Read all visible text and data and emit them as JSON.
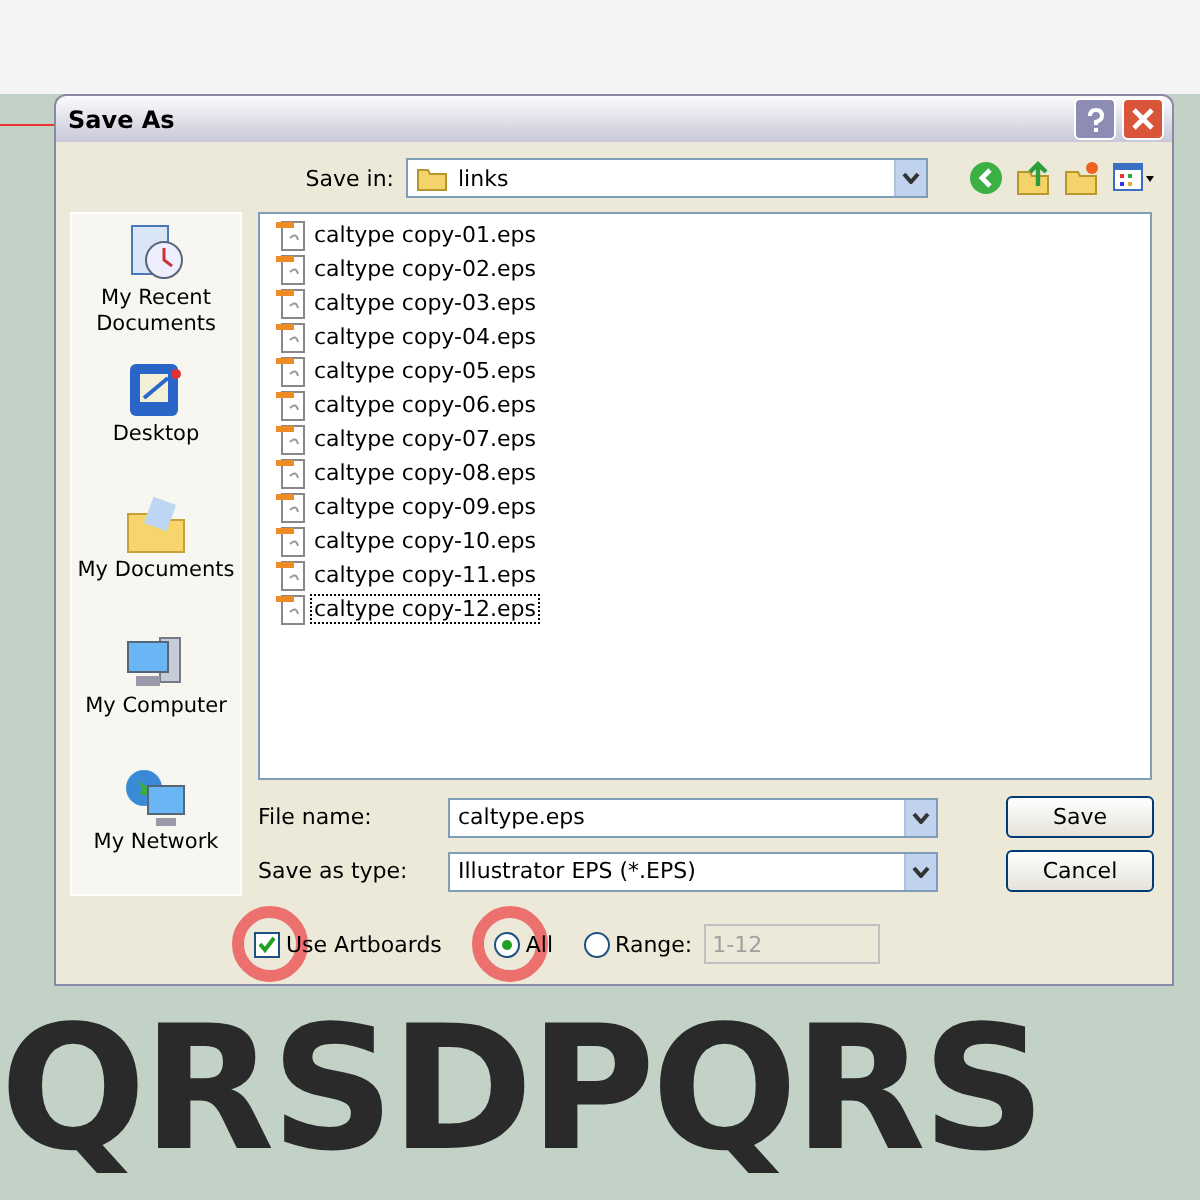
{
  "window": {
    "title": "Save As"
  },
  "save_in": {
    "label": "Save in:",
    "value": "links"
  },
  "places": [
    {
      "label": "My Recent Documents",
      "kind": "recent"
    },
    {
      "label": "Desktop",
      "kind": "desktop"
    },
    {
      "label": "My Documents",
      "kind": "documents"
    },
    {
      "label": "My Computer",
      "kind": "computer"
    },
    {
      "label": "My Network",
      "kind": "network"
    }
  ],
  "files": [
    {
      "name": "caltype copy-01.eps",
      "focused": false
    },
    {
      "name": "caltype copy-02.eps",
      "focused": false
    },
    {
      "name": "caltype copy-03.eps",
      "focused": false
    },
    {
      "name": "caltype copy-04.eps",
      "focused": false
    },
    {
      "name": "caltype copy-05.eps",
      "focused": false
    },
    {
      "name": "caltype copy-06.eps",
      "focused": false
    },
    {
      "name": "caltype copy-07.eps",
      "focused": false
    },
    {
      "name": "caltype copy-08.eps",
      "focused": false
    },
    {
      "name": "caltype copy-09.eps",
      "focused": false
    },
    {
      "name": "caltype copy-10.eps",
      "focused": false
    },
    {
      "name": "caltype copy-11.eps",
      "focused": false
    },
    {
      "name": "caltype copy-12.eps",
      "focused": true
    }
  ],
  "file_name": {
    "label": "File name:",
    "value": "caltype.eps"
  },
  "save_as_type": {
    "label": "Save as type:",
    "value": "Illustrator EPS (*.EPS)"
  },
  "buttons": [
    "Save",
    "Cancel"
  ],
  "use_artboards": {
    "label": "Use Artboards",
    "checked": true
  },
  "range_options": [
    {
      "label": "All",
      "selected": true
    },
    {
      "label": "Range:",
      "selected": false
    }
  ],
  "range_field": {
    "value": "1-12",
    "disabled": true
  },
  "artboard_letters": [
    "QRS",
    "DPQRS"
  ]
}
